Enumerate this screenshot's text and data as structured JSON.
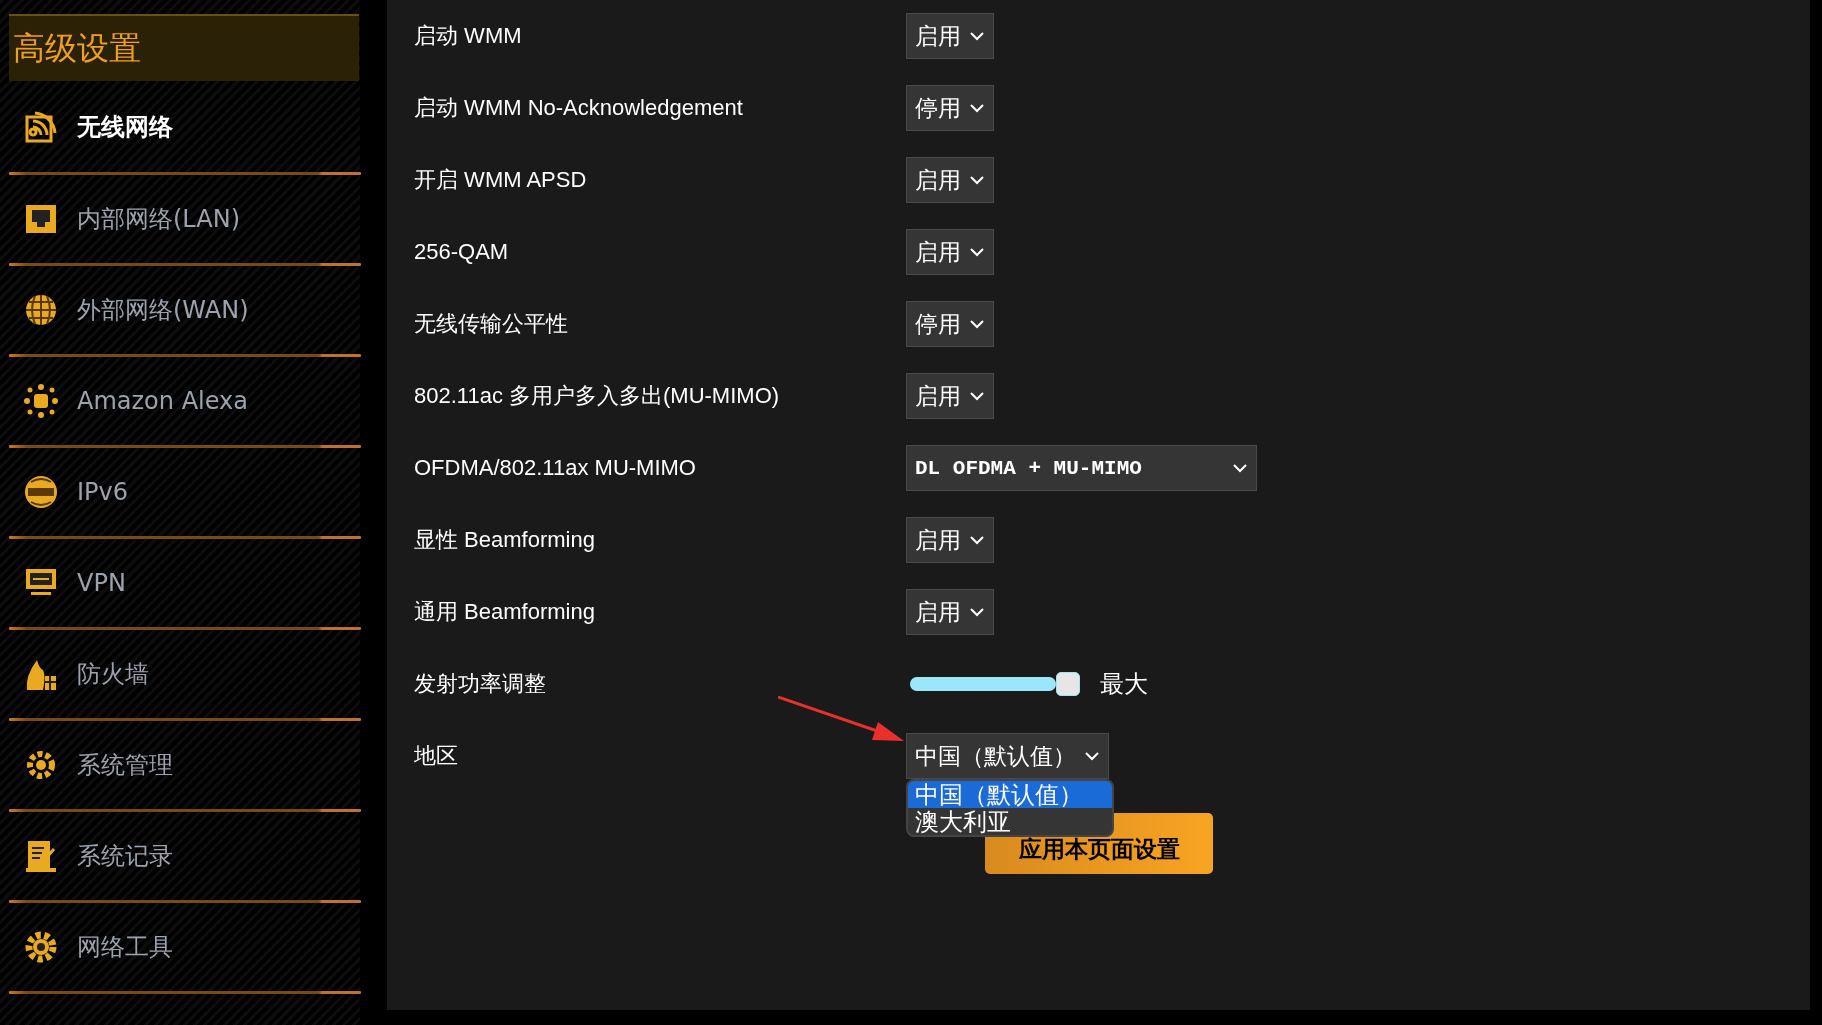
{
  "sidebar": {
    "title": "高级设置",
    "items": [
      {
        "label": "无线网络",
        "selected": true
      },
      {
        "label": "内部网络(LAN)",
        "selected": false
      },
      {
        "label": "外部网络(WAN)",
        "selected": false
      },
      {
        "label": "Amazon Alexa",
        "selected": false
      },
      {
        "label": "IPv6",
        "selected": false
      },
      {
        "label": "VPN",
        "selected": false
      },
      {
        "label": "防火墙",
        "selected": false
      },
      {
        "label": "系统管理",
        "selected": false
      },
      {
        "label": "系统记录",
        "selected": false
      },
      {
        "label": "网络工具",
        "selected": false
      }
    ]
  },
  "settings": [
    {
      "label": "启动 WMM",
      "kind": "select",
      "value": "启用"
    },
    {
      "label": "启动 WMM No-Acknowledgement",
      "kind": "select",
      "value": "停用"
    },
    {
      "label": "开启 WMM APSD",
      "kind": "select",
      "value": "启用"
    },
    {
      "label": "256-QAM",
      "kind": "select",
      "value": "启用"
    },
    {
      "label": "无线传输公平性",
      "kind": "select",
      "value": "停用"
    },
    {
      "label": "802.11ac 多用户多入多出(MU-MIMO)",
      "kind": "select",
      "value": "启用"
    },
    {
      "label": "OFDMA/802.11ax MU-MIMO",
      "kind": "wide_select",
      "value": "DL OFDMA + MU-MIMO"
    },
    {
      "label": "显性 Beamforming",
      "kind": "select",
      "value": "启用"
    },
    {
      "label": "通用 Beamforming",
      "kind": "select",
      "value": "启用"
    },
    {
      "label": "发射功率调整",
      "kind": "slider",
      "level": 1,
      "reading": "最大"
    },
    {
      "label": "地区",
      "kind": "select",
      "value": "中国（默认值）",
      "expanded": true,
      "options": [
        {
          "label": "中国（默认值）",
          "selected": true
        },
        {
          "label": "澳大利亚",
          "selected": false
        }
      ]
    }
  ],
  "apply_button": "应用本页面设置"
}
